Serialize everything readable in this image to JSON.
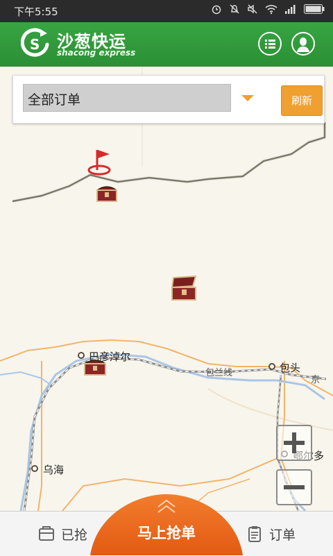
{
  "status_bar": {
    "time": "下午5:55",
    "icons": [
      "alarm-icon",
      "mute-icon",
      "sound-off-icon",
      "wifi-icon",
      "signal-icon",
      "battery-icon"
    ]
  },
  "header": {
    "brand_cn": "沙葱快运",
    "brand_en": "shacong express",
    "list_button_icon": "list-icon",
    "profile_button_icon": "user-icon",
    "color": "#2e9a3a"
  },
  "filter": {
    "selected": "全部订单",
    "refresh_label": "刷新",
    "accent": "#f0a030"
  },
  "map": {
    "places": [
      {
        "name": "巴彦淖尔"
      },
      {
        "name": "包头"
      },
      {
        "name": "包兰线"
      },
      {
        "name": "乌海"
      },
      {
        "name": "京"
      },
      {
        "name": "鄂尔多"
      }
    ],
    "markers": [
      "flag-icon",
      "treasure-chest-icon",
      "treasure-chest-icon",
      "treasure-chest-icon"
    ]
  },
  "zoom": {
    "in_label": "+",
    "out_label": "−"
  },
  "bottom_nav": {
    "grabbed_label": "已抢",
    "grab_now_label": "马上抢单",
    "orders_label": "订单",
    "grab_color": "#ee6a1f"
  }
}
